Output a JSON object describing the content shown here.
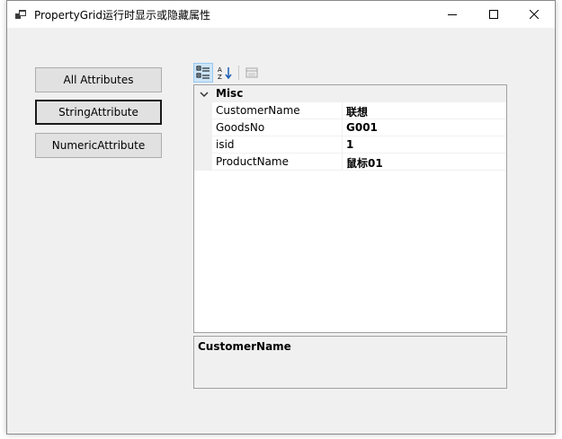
{
  "window": {
    "title": "PropertyGrid运行时显示或隐藏属性",
    "icons": {
      "app": "app-window-icon",
      "minimize": "minimize-icon",
      "maximize": "maximize-icon",
      "close": "close-icon"
    }
  },
  "buttons": [
    {
      "name": "all-attributes-button",
      "label": "All Attributes",
      "focused": false
    },
    {
      "name": "string-attribute-button",
      "label": "StringAttribute",
      "focused": true
    },
    {
      "name": "numeric-attribute-button",
      "label": "NumericAttribute",
      "focused": false
    }
  ],
  "toolbar": {
    "items": [
      {
        "name": "categorized-view-button",
        "icon": "categorized-icon",
        "active": true
      },
      {
        "name": "alphabetical-view-button",
        "icon": "sort-alphabetical-icon",
        "active": false
      },
      {
        "name": "property-pages-button",
        "icon": "property-pages-icon",
        "active": false,
        "disabled": true
      }
    ]
  },
  "grid": {
    "category": "Misc",
    "properties": [
      {
        "name": "CustomerName",
        "value": "联想"
      },
      {
        "name": "GoodsNo",
        "value": "G001"
      },
      {
        "name": "isid",
        "value": "1"
      },
      {
        "name": "ProductName",
        "value": "鼠标01"
      }
    ]
  },
  "description": {
    "title": "CustomerName",
    "text": ""
  },
  "colors": {
    "window_bg": "#f0f0f0",
    "titlebar_bg": "#ffffff",
    "button_bg": "#e1e1e1",
    "toolbar_active_bg": "#cce4f7",
    "toolbar_active_border": "#99c9ef",
    "grid_bg": "#ffffff",
    "grid_border": "#a0a0a0"
  }
}
